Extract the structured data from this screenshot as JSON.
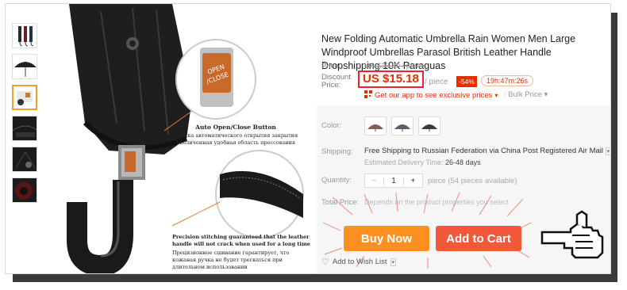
{
  "product": {
    "title": "New Folding Automatic Umbrella Rain Women Men Large Windproof Umbrellas Parasol British Leather Handle Dropshipping 10K Paraguas",
    "price_label": "Price:",
    "old_price": "US $33.00 / piece",
    "discount_price_label_line1": "Discount",
    "discount_price_label_line2": "Price:",
    "current_price": "US $15.18",
    "per_piece": "/ piece",
    "discount_badge": "-54%",
    "countdown": "19h:47m:26s",
    "app_link": "Get our app to see exclusive prices",
    "bulk_price": "Bulk Price",
    "color_label": "Color:",
    "shipping_label": "Shipping:",
    "shipping_text": "Free Shipping to Russian Federation via China Post Registered Air Mail",
    "delivery_label": "Estimated Delivery Time:",
    "delivery_value": "26-48 days",
    "quantity_label": "Quantity:",
    "quantity_minus": "−",
    "quantity_value": "1",
    "quantity_plus": "+",
    "pieces_available": "piece (54 pieces available)",
    "total_label": "Total Price:",
    "total_note": "Depends on the product properties you select",
    "buy_now": "Buy Now",
    "add_to_cart": "Add to Cart",
    "wishlist": "Add to Wish List"
  },
  "image_annotations": {
    "button_callout": "Auto Open/Close Button",
    "button_ru_1": "Кнопка автоматического открытия закрытия",
    "button_ru_2": "Увеличенная удобная область прессования",
    "stitch_en_1": "Precision stitching guaranteed that the leather",
    "stitch_en_2": "handle will not crack when used for a long time",
    "stitch_ru_1": "Прецизионное сшивание гарантирует, что",
    "stitch_ru_2": "кожаная ручка не будет трескаться при",
    "stitch_ru_3": "длительном использовании",
    "button_face_1": "OPEN",
    "button_face_2": "/CLOSE"
  },
  "colors": {
    "accent_orange": "#fb9021",
    "accent_red": "#e62e04",
    "cart_red": "#f1593a"
  },
  "icons": {
    "app_qr": "qr-code-icon",
    "bulk_caret": "caret-down-icon",
    "wishlist": "heart-icon",
    "pointer": "pointing-hand-icon"
  }
}
